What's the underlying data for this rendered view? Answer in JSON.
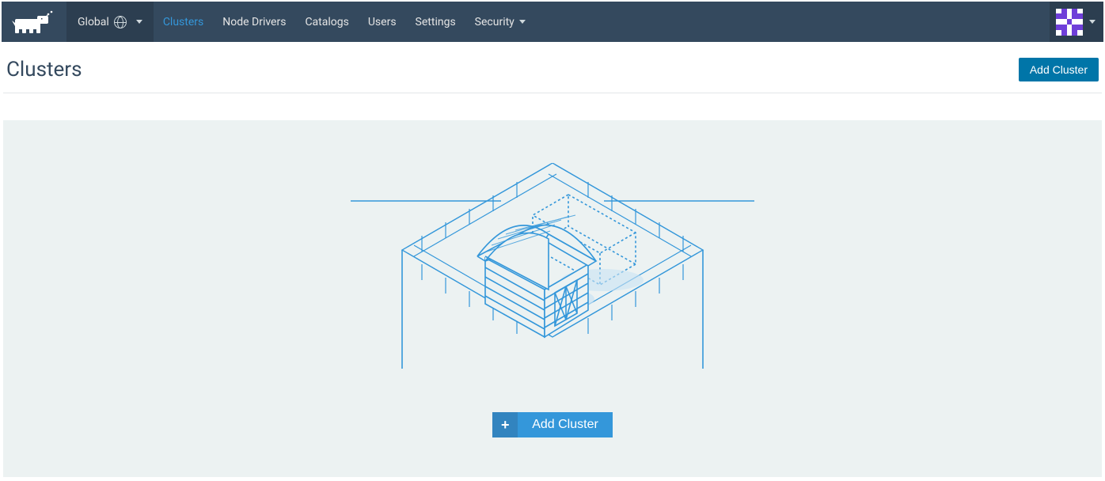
{
  "nav": {
    "scope_label": "Global",
    "items": [
      {
        "label": "Clusters",
        "active": true
      },
      {
        "label": "Node Drivers"
      },
      {
        "label": "Catalogs"
      },
      {
        "label": "Users"
      },
      {
        "label": "Settings"
      },
      {
        "label": "Security",
        "dropdown": true
      }
    ]
  },
  "page": {
    "title": "Clusters",
    "add_button": "Add Cluster"
  },
  "empty_state": {
    "add_button": "Add Cluster"
  },
  "colors": {
    "accent": "#3497da",
    "primary_button": "#0075a8",
    "topbar_bg": "#34495e",
    "topbar_dark": "#2c3e50"
  }
}
